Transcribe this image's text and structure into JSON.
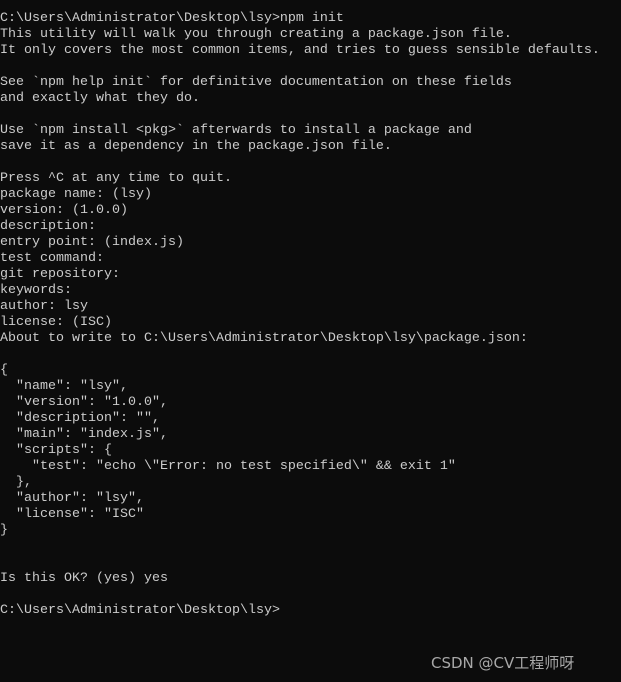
{
  "terminal": {
    "lines": [
      "C:\\Users\\Administrator\\Desktop\\lsy>npm init",
      "This utility will walk you through creating a package.json file.",
      "It only covers the most common items, and tries to guess sensible defaults.",
      "",
      "See `npm help init` for definitive documentation on these fields",
      "and exactly what they do.",
      "",
      "Use `npm install <pkg>` afterwards to install a package and",
      "save it as a dependency in the package.json file.",
      "",
      "Press ^C at any time to quit.",
      "package name: (lsy)",
      "version: (1.0.0)",
      "description:",
      "entry point: (index.js)",
      "test command:",
      "git repository:",
      "keywords:",
      "author: lsy",
      "license: (ISC)",
      "About to write to C:\\Users\\Administrator\\Desktop\\lsy\\package.json:",
      "",
      "{",
      "  \"name\": \"lsy\",",
      "  \"version\": \"1.0.0\",",
      "  \"description\": \"\",",
      "  \"main\": \"index.js\",",
      "  \"scripts\": {",
      "    \"test\": \"echo \\\"Error: no test specified\\\" && exit 1\"",
      "  },",
      "  \"author\": \"lsy\",",
      "  \"license\": \"ISC\"",
      "}",
      "",
      "",
      "Is this OK? (yes) yes",
      "",
      "C:\\Users\\Administrator\\Desktop\\lsy>"
    ]
  },
  "watermark": "CSDN @CV工程师呀",
  "colors": {
    "background": "#0c0c0c",
    "text": "#cccccc"
  }
}
